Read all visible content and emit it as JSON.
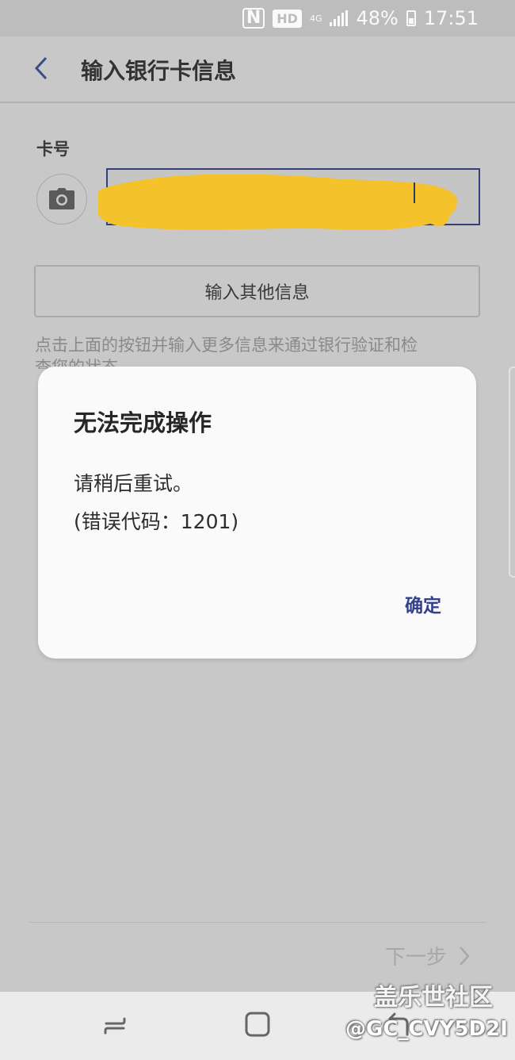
{
  "status_bar": {
    "nfc": "N",
    "hd": "HD",
    "network": "4G",
    "battery": "48%",
    "time": "17:51"
  },
  "toolbar": {
    "title": "输入银行卡信息"
  },
  "form": {
    "card_label": "卡号",
    "other_info_button": "输入其他信息",
    "hint": "点击上面的按钮并输入更多信息来通过银行验证和检查您的状态"
  },
  "dialog": {
    "title": "无法完成操作",
    "message": "请稍后重试。",
    "error_code": "(错误代码：1201)",
    "confirm": "确定"
  },
  "footer": {
    "next": "下一步"
  },
  "watermark": {
    "title": "盖乐世社区",
    "id": "@GC_CVY5D2I"
  },
  "colors": {
    "accent": "#35418a",
    "scribble": "#f4c22b",
    "overlay_bg": "#c8c8c8"
  }
}
